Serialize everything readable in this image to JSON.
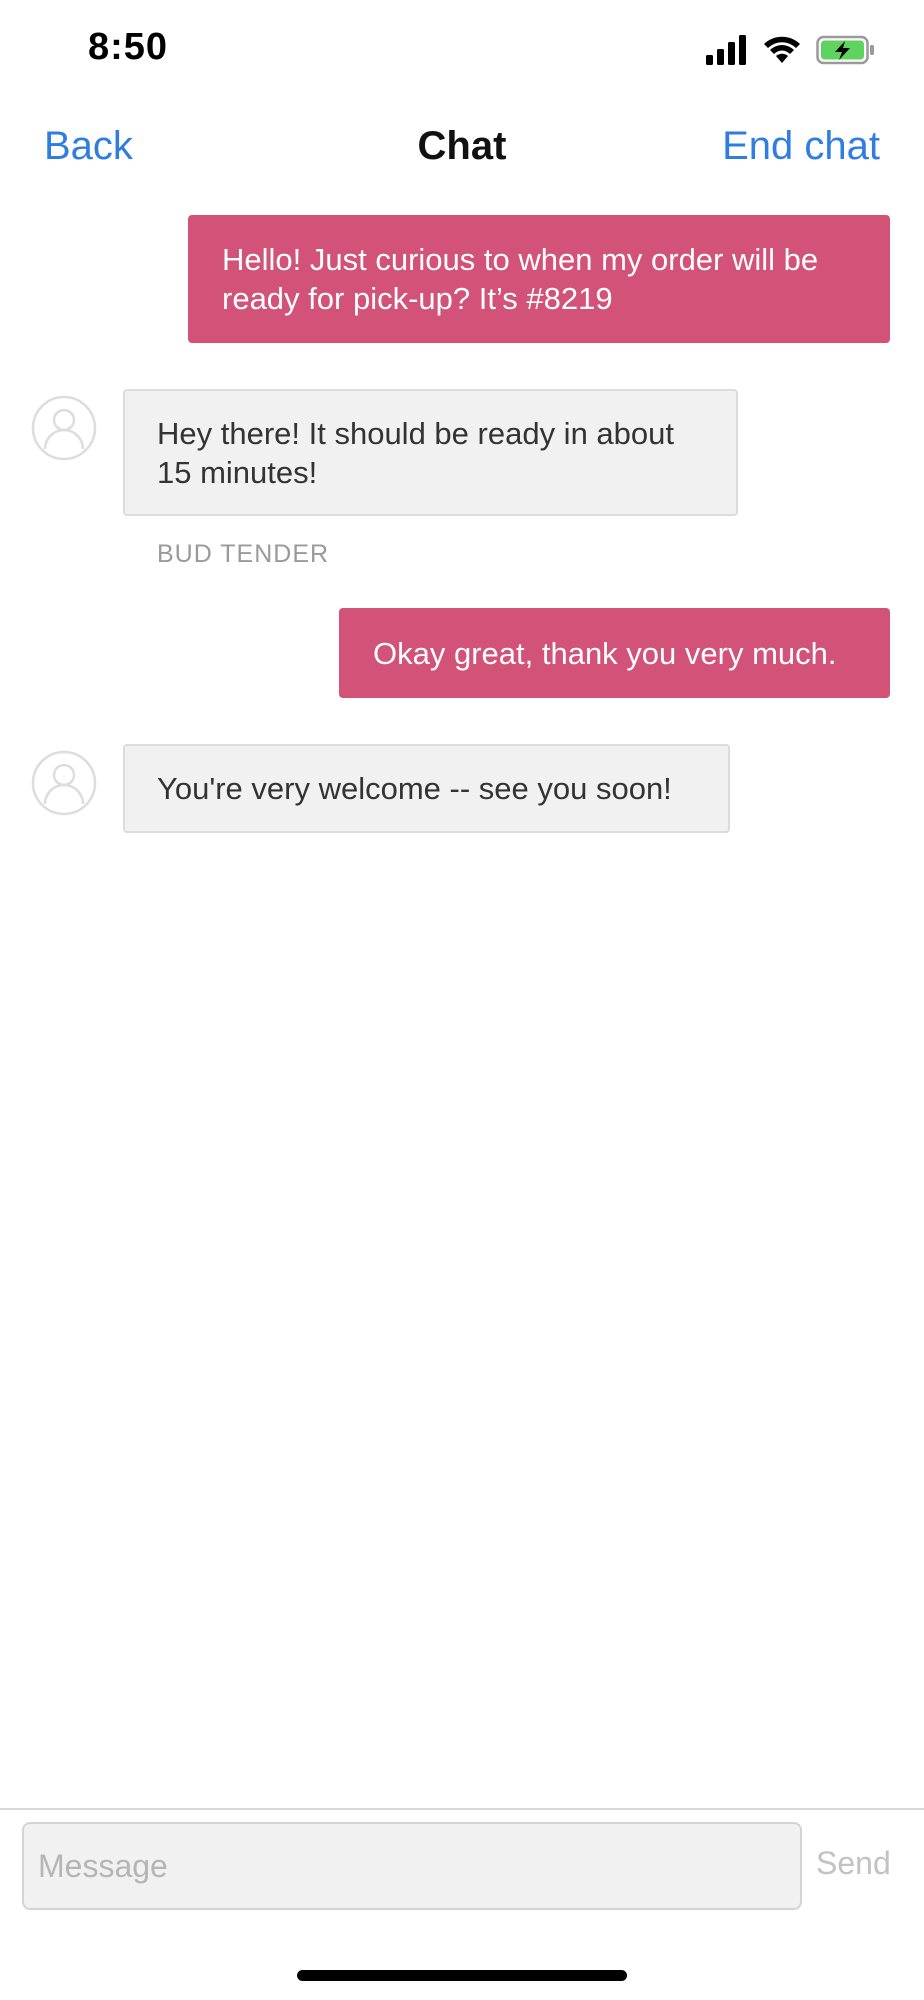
{
  "status_bar": {
    "time": "8:50"
  },
  "nav": {
    "back_label": "Back",
    "title": "Chat",
    "end_label": "End chat"
  },
  "messages": [
    {
      "direction": "outgoing",
      "text": "Hello! Just curious to when my order will be ready for pick-up? It’s #8219"
    },
    {
      "direction": "incoming",
      "text": "Hey there! It should be ready in about 15 minutes!",
      "sender": "BUD TENDER"
    },
    {
      "direction": "outgoing",
      "text": "Okay great, thank you very much."
    },
    {
      "direction": "incoming",
      "text": "You're very welcome -- see you soon!"
    }
  ],
  "composer": {
    "placeholder": "Message",
    "value": "",
    "send_label": "Send"
  },
  "colors": {
    "accent": "#2f7de1",
    "outgoing_bubble": "#d35277",
    "incoming_bubble": "#f1f1f1",
    "send_disabled": "#c2c2c2"
  },
  "icons": {
    "signal": "cellular-signal-icon",
    "wifi": "wifi-icon",
    "battery": "battery-charging-icon",
    "avatar": "user-avatar-icon"
  }
}
